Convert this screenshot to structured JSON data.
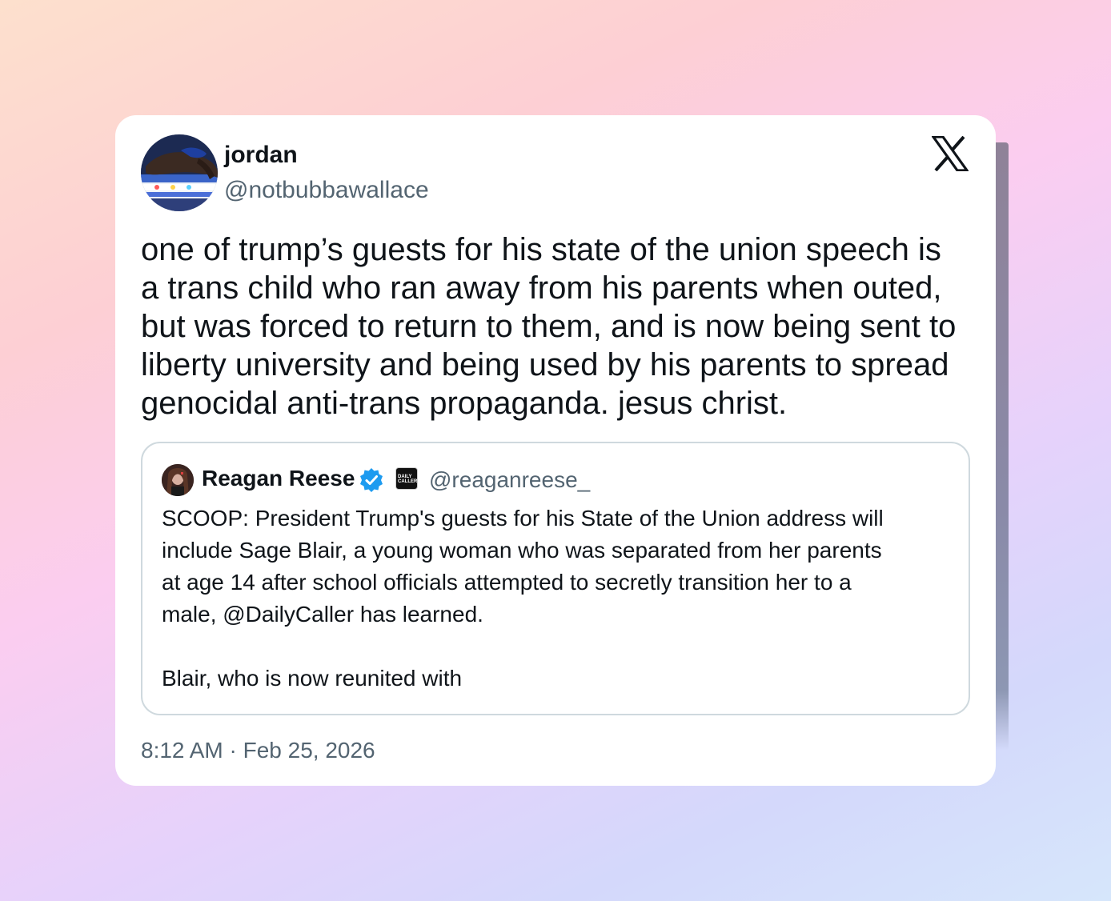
{
  "author": {
    "display_name": "jordan",
    "handle": "@notbubbawallace"
  },
  "tweet": {
    "text": "one of trump’s guests for his state of the union speech is\na trans child who ran away from his parents when outed,\nbut was forced to return to them, and is now being sent to\nliberty university and being used by his parents to spread\ngenocidal anti-trans propaganda. jesus christ.",
    "timestamp": "8:12 AM · Feb 25, 2026"
  },
  "quote": {
    "display_name": "Reagan Reese",
    "handle": "@reaganreese_",
    "affiliation_badge": "DAILY CALLER",
    "text": "SCOOP: President Trump's guests for his State of the Union address will\ninclude Sage Blair, a young woman who was separated from her parents\nat age 14 after school officials attempted to secretly transition her to a\nmale, @DailyCaller has learned.\n\nBlair, who is now reunited with"
  },
  "icons": {
    "platform_logo": "x-logo-icon",
    "verified": "verified-badge-icon"
  },
  "colors": {
    "text_primary": "#0f1419",
    "text_secondary": "#536471",
    "verified_blue": "#1d9bf0",
    "border": "#cfd9de"
  }
}
